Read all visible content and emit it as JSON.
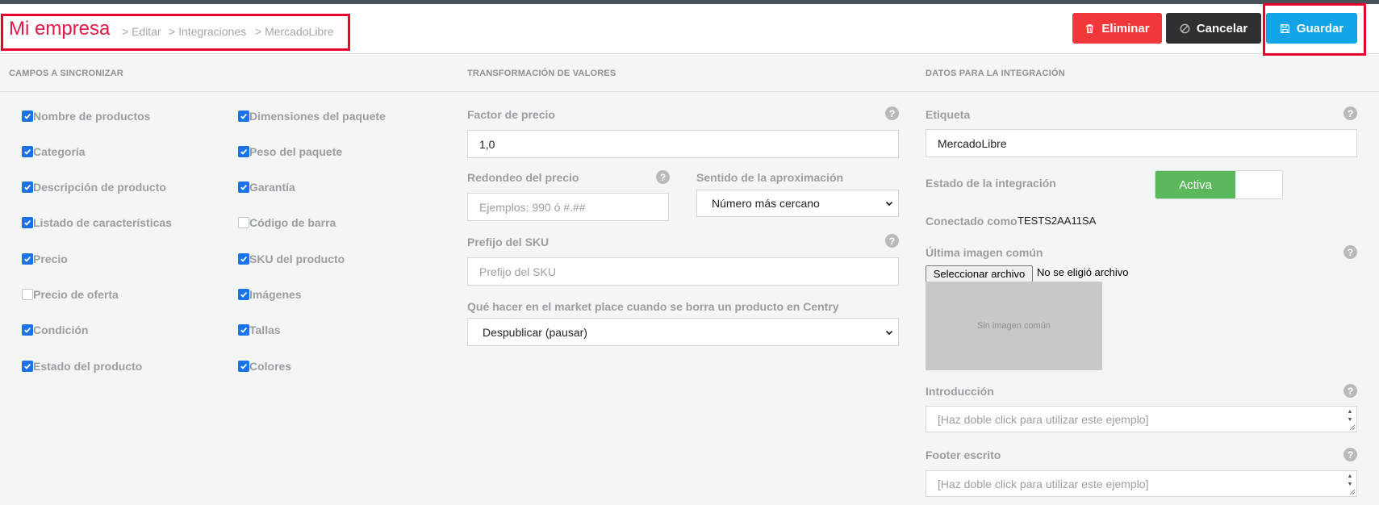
{
  "header": {
    "brand": "Mi empresa",
    "breadcrumb": [
      "> Editar",
      "> Integraciones",
      "> MercadoLibre"
    ],
    "buttons": {
      "delete": "Eliminar",
      "cancel": "Cancelar",
      "save": "Guardar"
    }
  },
  "sections": {
    "sync_fields": "CAMPOS A SINCRONIZAR",
    "transform": "TRANSFORMACIÓN DE VALORES",
    "integration": "DATOS PARA LA INTEGRACIÓN"
  },
  "checkboxes": {
    "col1": [
      {
        "label": "Nombre de productos",
        "checked": true
      },
      {
        "label": "Categoría",
        "checked": true
      },
      {
        "label": "Descripción de producto",
        "checked": true
      },
      {
        "label": "Listado de características",
        "checked": true
      },
      {
        "label": "Precio",
        "checked": true
      },
      {
        "label": "Precio de oferta",
        "checked": false
      },
      {
        "label": "Condición",
        "checked": true
      },
      {
        "label": "Estado del producto",
        "checked": true
      }
    ],
    "col2": [
      {
        "label": "Dimensiones del paquete",
        "checked": true
      },
      {
        "label": "Peso del paquete",
        "checked": true
      },
      {
        "label": "Garantía",
        "checked": true
      },
      {
        "label": "Código de barra",
        "checked": false
      },
      {
        "label": "SKU del producto",
        "checked": true
      },
      {
        "label": "Imágenes",
        "checked": true
      },
      {
        "label": "Tallas",
        "checked": true
      },
      {
        "label": "Colores",
        "checked": true
      }
    ]
  },
  "transform": {
    "price_factor_label": "Factor de precio",
    "price_factor_value": "1,0",
    "rounding_label": "Redondeo del precio",
    "rounding_placeholder": "Ejemplos: 990 ó #.##",
    "direction_label": "Sentido de la aproximación",
    "direction_value": "Número más cercano",
    "sku_prefix_label": "Prefijo del SKU",
    "sku_prefix_placeholder": "Prefijo del SKU",
    "on_delete_label": "Qué hacer en el market place cuando se borra un producto en Centry",
    "on_delete_value": "Despublicar (pausar)"
  },
  "integration": {
    "tag_label": "Etiqueta",
    "tag_value": "MercadoLibre",
    "status_label": "Estado de la integración",
    "status_value": "Activa",
    "connected_label": "Conectado como",
    "connected_value": "TESTS2AA11SA",
    "last_image_label": "Última imagen común",
    "file_button": "Seleccionar archivo",
    "file_status": "No se eligió archivo",
    "no_image": "Sin imagen común",
    "intro_label": "Introducción",
    "intro_placeholder": "[Haz doble click para utilizar este ejemplo]",
    "footer_label": "Footer escrito",
    "footer_placeholder": "[Haz doble click para utilizar este ejemplo]"
  },
  "help_glyph": "?",
  "colors": {
    "brand": "#e11a45",
    "delete": "#f0383a",
    "cancel": "#2f3033",
    "save": "#13a4e8",
    "active": "#5cb85c",
    "highlight": "#e8002b"
  }
}
